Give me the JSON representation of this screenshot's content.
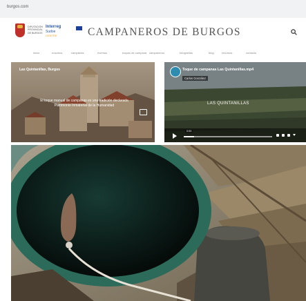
{
  "browser": {
    "url": "burgos.com"
  },
  "header": {
    "title": "CAMPANEROS  DE  BURGOS",
    "province_lines": [
      "DIPUTACIÓN",
      "PROVINCIAL",
      "DE BURGOS"
    ],
    "interreg": {
      "line1": "Interreg",
      "line2": "Sudoe",
      "line3": "CENTRE"
    }
  },
  "nav": {
    "items": [
      "inicio",
      "nosotros",
      "campanas",
      "eventos",
      "toques de campana",
      "campaneros",
      "fotografías",
      "blog",
      "recursos",
      "contacto"
    ]
  },
  "panels": {
    "left": {
      "caption": "Las Quintanillas, Burgos",
      "text_line1": "El toque manual de campanas es una tradición declarada",
      "text_line2": "Patrimonio Inmaterial de la Humanidad"
    },
    "right": {
      "video_title": "Toque de campanas Las Quintanillas.mp4",
      "author": "Carlos González",
      "center_label": "LAS QUINTANILLAS",
      "timestamp": "0:00",
      "progress": 0.12
    }
  },
  "colors": {
    "accent_blue": "#2e5aa8",
    "shield_red": "#c0302a",
    "bell_green": "#245b4e"
  }
}
